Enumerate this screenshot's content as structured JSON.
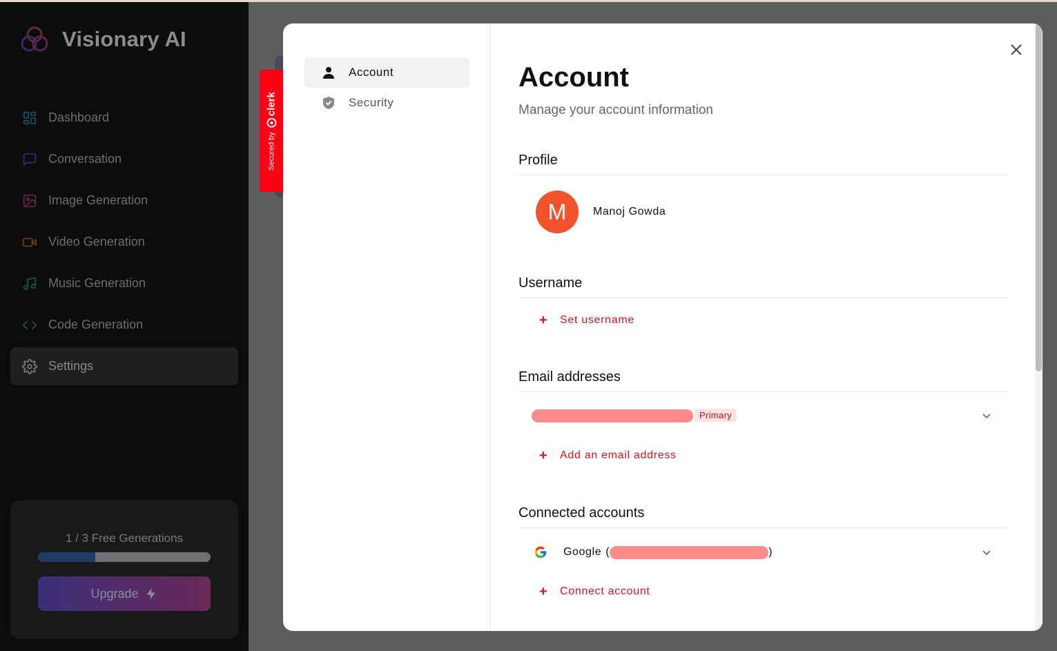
{
  "app": {
    "name": "Visionary AI"
  },
  "sidebar": {
    "items": [
      {
        "label": "Dashboard",
        "icon": "layout-dashboard-icon",
        "color": "#0ea5e9"
      },
      {
        "label": "Conversation",
        "icon": "message-square-icon",
        "color": "#8b5cf6"
      },
      {
        "label": "Image Generation",
        "icon": "image-icon",
        "color": "#ec4899"
      },
      {
        "label": "Video Generation",
        "icon": "video-icon",
        "color": "#f97316"
      },
      {
        "label": "Music Generation",
        "icon": "music-icon",
        "color": "#10b981"
      },
      {
        "label": "Code Generation",
        "icon": "code-icon",
        "color": "#22c55e"
      },
      {
        "label": "Settings",
        "icon": "settings-icon",
        "color": "#cccccc",
        "active": true
      }
    ],
    "free_generations": {
      "text": "1 / 3 Free Generations",
      "used": 1,
      "total": 3
    },
    "upgrade_label": "Upgrade"
  },
  "clerk_badge": {
    "secured_by": "Secured by",
    "brand": "clerk"
  },
  "modal": {
    "nav": [
      {
        "label": "Account",
        "icon": "user-icon",
        "active": true
      },
      {
        "label": "Security",
        "icon": "shield-check-icon",
        "active": false
      }
    ],
    "title": "Account",
    "subtitle": "Manage your account information",
    "profile": {
      "section_title": "Profile",
      "avatar_initial": "M",
      "avatar_color": "#f2532a",
      "name": "Manoj Gowda"
    },
    "username": {
      "section_title": "Username",
      "action": "Set username"
    },
    "email": {
      "section_title": "Email addresses",
      "primary_badge": "Primary",
      "action": "Add an email address"
    },
    "connected": {
      "section_title": "Connected accounts",
      "provider": "Google",
      "open_paren": "(",
      "close_paren": ")",
      "action": "Connect account"
    },
    "accent_color": "#e3111d"
  }
}
